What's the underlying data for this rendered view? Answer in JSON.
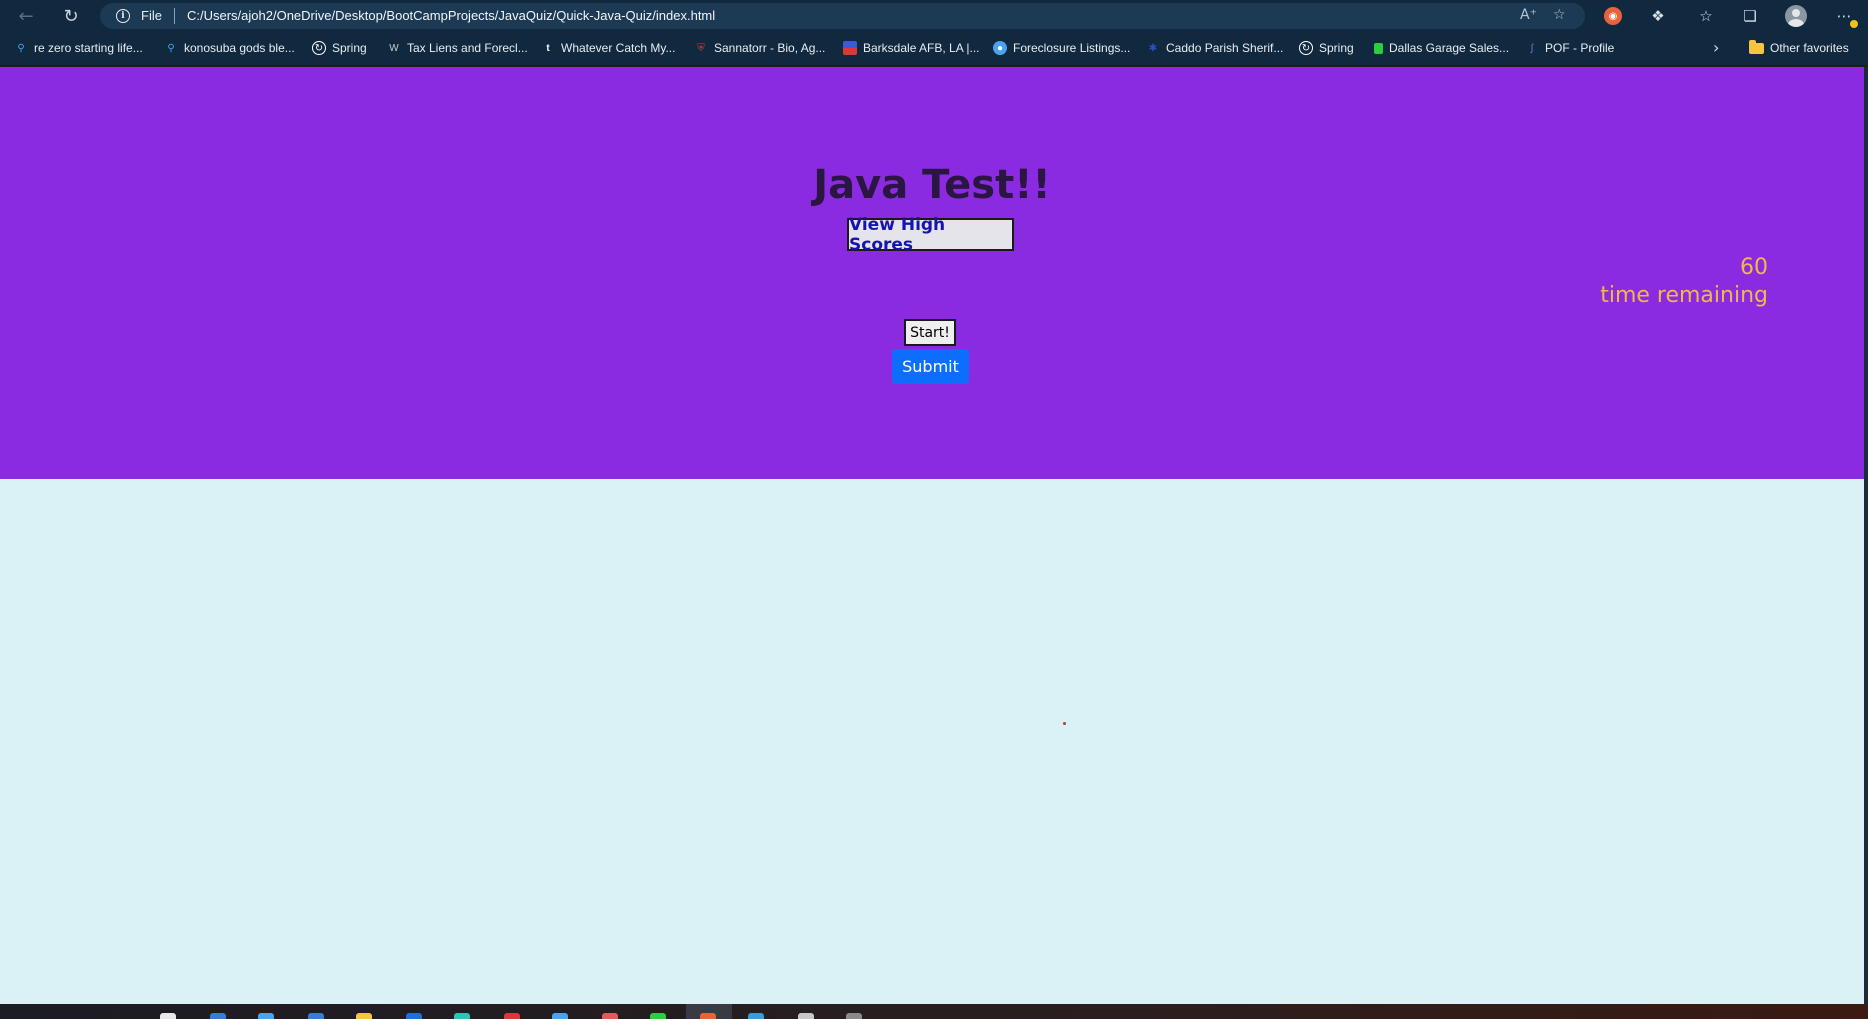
{
  "browser": {
    "address_bar": {
      "scheme_label": "File",
      "url": "C:/Users/ajoh2/OneDrive/Desktop/BootCampProjects/JavaQuiz/Quick-Java-Quiz/index.html"
    },
    "bookmarks": [
      {
        "label": "re zero starting life...",
        "icon": "search-icon",
        "color": "#4aa3f0"
      },
      {
        "label": "konosuba gods ble...",
        "icon": "search-icon",
        "color": "#4aa3f0"
      },
      {
        "label": "Spring",
        "icon": "spring-icon",
        "color": "#ffffff"
      },
      {
        "label": "Tax Liens and Forecl...",
        "icon": "wings-icon",
        "color": "#c8c8c8"
      },
      {
        "label": "Whatever Catch My...",
        "icon": "tumblr-icon",
        "color": "#ffffff"
      },
      {
        "label": "Sannatorr - Bio, Ag...",
        "icon": "shield-icon",
        "color": "#d83a3a"
      },
      {
        "label": "Barksdale AFB, LA |...",
        "icon": "flag-icon",
        "color": "#3a5ad8"
      },
      {
        "label": "Foreclosure Listings...",
        "icon": "globe-icon",
        "color": "#4aa3f0"
      },
      {
        "label": "Caddo Parish Sherif...",
        "icon": "star-badge-icon",
        "color": "#2a50c8"
      },
      {
        "label": "Spring",
        "icon": "spring-icon",
        "color": "#ffffff"
      },
      {
        "label": "Dallas Garage Sales...",
        "icon": "square-icon",
        "color": "#2ecc40"
      },
      {
        "label": "POF - Profile",
        "icon": "fish-icon",
        "color": "#8a6ad8"
      }
    ],
    "other_favorites": "Other favorites"
  },
  "page": {
    "title": "Java Test!!",
    "high_scores_button": "View High Scores",
    "timer": {
      "value": "60",
      "label": "time remaining"
    },
    "start_button": "Start!",
    "submit_button": "Submit"
  },
  "colors": {
    "hero_background": "#8a2be2",
    "page_background": "#daf1f6",
    "timer_text": "#f0b84a",
    "submit_button": "#0d6efd",
    "high_scores_text": "#1414b0"
  }
}
